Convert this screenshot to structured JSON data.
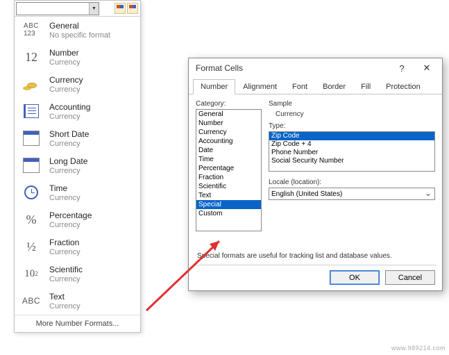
{
  "panel": {
    "items": [
      {
        "icon": "abc123",
        "name": "General",
        "sub": "No specific format"
      },
      {
        "icon": "12",
        "name": "Number",
        "sub": "Currency"
      },
      {
        "icon": "coins",
        "name": "Currency",
        "sub": "Currency"
      },
      {
        "icon": "book",
        "name": "Accounting",
        "sub": "Currency"
      },
      {
        "icon": "cal",
        "name": "Short Date",
        "sub": "Currency"
      },
      {
        "icon": "cal",
        "name": "Long Date",
        "sub": "Currency"
      },
      {
        "icon": "clock",
        "name": "Time",
        "sub": "Currency"
      },
      {
        "icon": "pct",
        "name": "Percentage",
        "sub": "Currency"
      },
      {
        "icon": "frac",
        "name": "Fraction",
        "sub": "Currency"
      },
      {
        "icon": "sci",
        "name": "Scientific",
        "sub": "Currency"
      },
      {
        "icon": "abc",
        "name": "Text",
        "sub": "Currency"
      }
    ],
    "more": "More Number Formats..."
  },
  "dialog": {
    "title": "Format Cells",
    "tabs": [
      "Number",
      "Alignment",
      "Font",
      "Border",
      "Fill",
      "Protection"
    ],
    "category": {
      "label": "Category:",
      "items": [
        "General",
        "Number",
        "Currency",
        "Accounting",
        "Date",
        "Time",
        "Percentage",
        "Fraction",
        "Scientific",
        "Text",
        "Special",
        "Custom"
      ],
      "selected": 10
    },
    "sample": {
      "label": "Sample",
      "value": "Currency"
    },
    "type": {
      "label": "Type:",
      "items": [
        "Zip Code",
        "Zip Code + 4",
        "Phone Number",
        "Social Security Number"
      ],
      "selected": 0
    },
    "locale": {
      "label": "Locale (location):",
      "value": "English (United States)"
    },
    "hint": "Special formats are useful for tracking list and database values.",
    "ok": "OK",
    "cancel": "Cancel",
    "help": "?",
    "close": "✕"
  },
  "watermark": "www.989214.com"
}
